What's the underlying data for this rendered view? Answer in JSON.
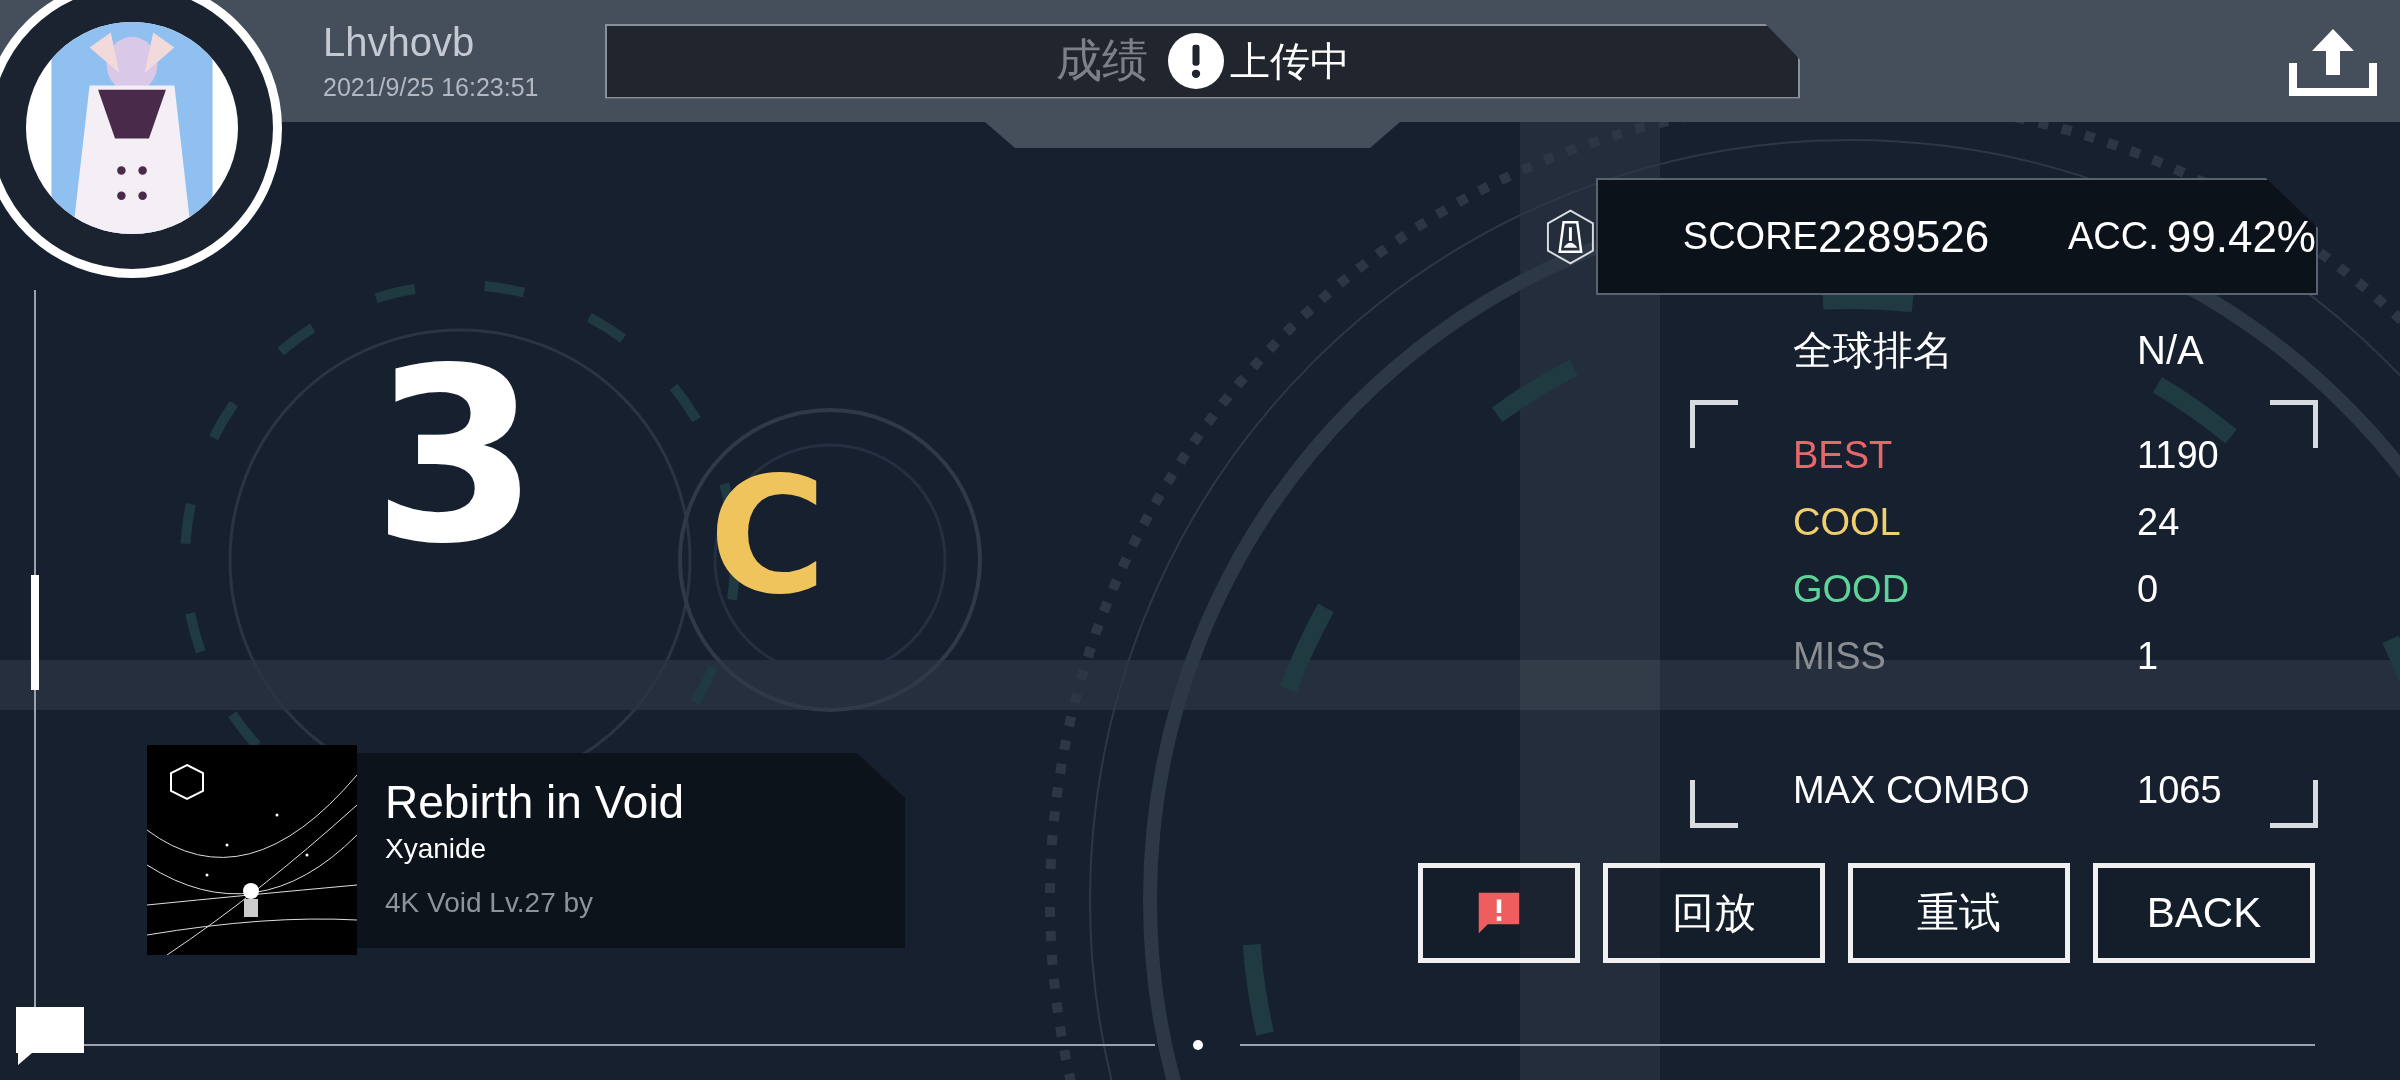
{
  "player": {
    "name": "Lhvhovb",
    "datetime": "2021/9/25 16:23:51"
  },
  "banner": {
    "title": "成绩",
    "toast": "上传中"
  },
  "result": {
    "big_number": "3",
    "rank": "C"
  },
  "score": {
    "label": "SCORE",
    "value": "2289526",
    "acc_label": "ACC.",
    "acc_value": "99.42%"
  },
  "global_rank": {
    "label": "全球排名",
    "value": "N/A"
  },
  "judgements": [
    {
      "label": "BEST",
      "value": "1190",
      "color": "#e8676b"
    },
    {
      "label": "COOL",
      "value": "24",
      "color": "#f2cf6e"
    },
    {
      "label": "GOOD",
      "value": "0",
      "color": "#5fd39a"
    },
    {
      "label": "MISS",
      "value": "1",
      "color": "#8a8d92"
    }
  ],
  "max_combo": {
    "label": "MAX COMBO",
    "value": "1065"
  },
  "song": {
    "title": "Rebirth in Void",
    "artist": "Xyanide",
    "info": "4K Void Lv.27 by"
  },
  "buttons": [
    {
      "kind": "icon"
    },
    {
      "kind": "text",
      "label": "回放"
    },
    {
      "kind": "text",
      "label": "重试"
    },
    {
      "kind": "text",
      "label": "BACK"
    }
  ]
}
